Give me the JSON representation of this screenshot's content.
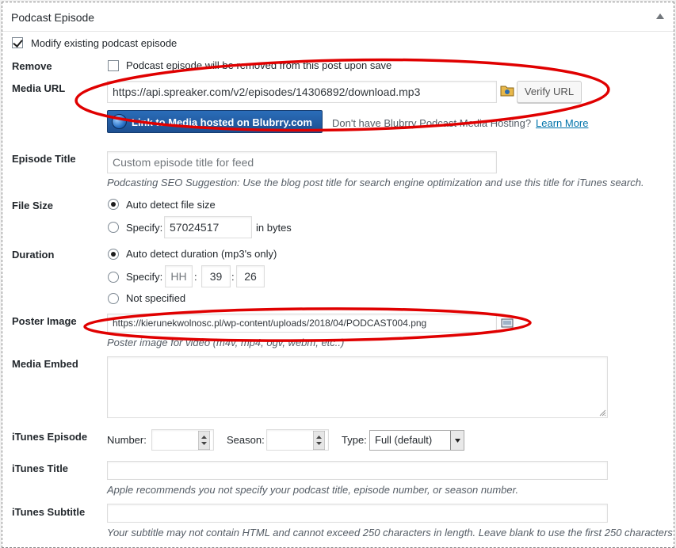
{
  "panel": {
    "title": "Podcast Episode"
  },
  "modify": {
    "label": "Modify existing podcast episode",
    "checked": true
  },
  "remove": {
    "label": "Remove",
    "checkbox_text": "Podcast episode will be removed from this post upon save"
  },
  "media_url": {
    "label": "Media URL",
    "value": "https://api.spreaker.com/v2/episodes/14306892/download.mp3",
    "verify_button": "Verify URL",
    "link_media_button": "Link to Media hosted on Blubrry.com",
    "hosting_text": "Don't have Blubrry Podcast Media Hosting?",
    "learn_more": "Learn More"
  },
  "episode_title": {
    "label": "Episode Title",
    "placeholder": "Custom episode title for feed",
    "help": "Podcasting SEO Suggestion: Use the blog post title for search engine optimization and use this title for iTunes search."
  },
  "file_size": {
    "label": "File Size",
    "auto_label": "Auto detect file size",
    "specify_label": "Specify:",
    "value": "57024517",
    "unit": "in bytes"
  },
  "duration": {
    "label": "Duration",
    "auto_label": "Auto detect duration (mp3's only)",
    "specify_label": "Specify:",
    "hh_placeholder": "HH",
    "mm": "39",
    "ss": "26",
    "separator": ":",
    "not_specified": "Not specified"
  },
  "poster_image": {
    "label": "Poster Image",
    "value": "https://kierunekwolnosc.pl/wp-content/uploads/2018/04/PODCAST004.png",
    "help": "Poster image for video (m4v, mp4, ogv, webm, etc..)"
  },
  "media_embed": {
    "label": "Media Embed"
  },
  "itunes_episode": {
    "label": "iTunes Episode",
    "number_label": "Number:",
    "season_label": "Season:",
    "type_label": "Type:",
    "type_value": "Full (default)"
  },
  "itunes_title": {
    "label": "iTunes Title",
    "help": "Apple recommends you not specify your podcast title, episode number, or season number."
  },
  "itunes_subtitle": {
    "label": "iTunes Subtitle",
    "help": "Your subtitle may not contain HTML and cannot exceed 250 characters in length. Leave blank to use the first 250 characters"
  },
  "annotation_color": "#e00000"
}
